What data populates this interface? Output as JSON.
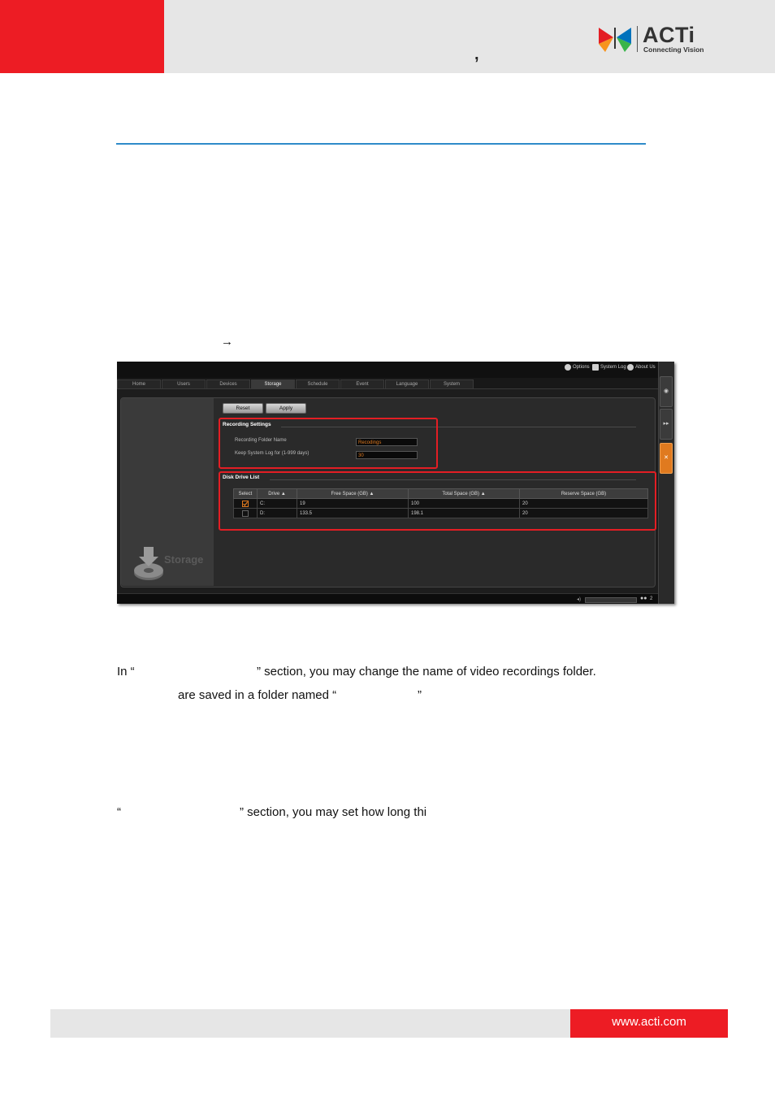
{
  "header": {
    "comma": ",",
    "logo": {
      "name": "ACTi",
      "tagline": "Connecting Vision"
    }
  },
  "arrow": "→",
  "app": {
    "toplinks": [
      "Options",
      "System Log",
      "About Us"
    ],
    "tabs": [
      "Home",
      "Users",
      "Devices",
      "Storage",
      "Schedule",
      "Event",
      "Language",
      "System"
    ],
    "active_tab": "Storage",
    "sidebar_title": "Storage",
    "buttons": {
      "reset": "Reset",
      "apply": "Apply"
    },
    "recording_settings": {
      "title": "Recording Settings",
      "folder_label": "Recording Folder Name",
      "folder_value": "Recodings",
      "log_label": "Keep System Log for (1-999 days)",
      "log_value": "30"
    },
    "disk_drive_list": {
      "title": "Disk Drive List",
      "columns": [
        "Select",
        "Drive ▲",
        "Free Space (GB) ▲",
        "Total Space (GB) ▲",
        "Reserve Space (GB)"
      ],
      "rows": [
        {
          "selected": true,
          "drive": "C:",
          "free": "19",
          "total": "100",
          "reserve": "20"
        },
        {
          "selected": false,
          "drive": "D:",
          "free": "133.5",
          "total": "198.1",
          "reserve": "20"
        }
      ]
    },
    "status": {
      "users": "2"
    },
    "colors": {
      "highlight": "#e31e24",
      "accent": "#e07a1f"
    }
  },
  "text": {
    "p1_left": "In “",
    "p1_right": "” section, you may change the name of video recordings folder.",
    "p2": "are saved in a folder named “",
    "p2_close": "”",
    "p3_open": "“",
    "p3_right": "” section, you may set how long thi"
  },
  "footer": {
    "url": "www.acti.com"
  },
  "colors": {
    "brand_red": "#ed1c24",
    "header_gray": "#e6e6e6",
    "rule_blue": "#2f8bc9"
  }
}
